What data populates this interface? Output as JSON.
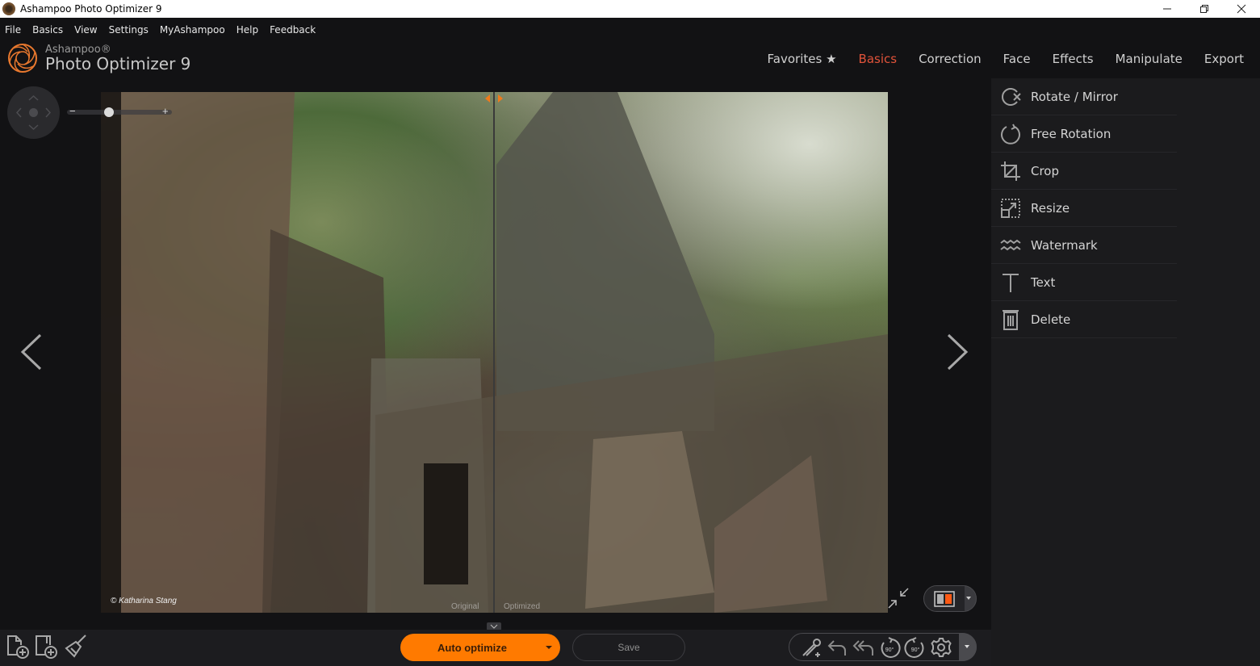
{
  "window": {
    "title": "Ashampoo Photo Optimizer 9",
    "controls": {
      "minimize": "minimize-icon",
      "restore": "restore-icon",
      "close": "close-icon"
    }
  },
  "menu": [
    "File",
    "Basics",
    "View",
    "Settings",
    "MyAshampoo",
    "Help",
    "Feedback"
  ],
  "brand": {
    "company": "Ashampoo®",
    "product": "Photo Optimizer 9",
    "logo_color": "#e8782e"
  },
  "tabs": [
    {
      "label": "Favorites ★",
      "active": false
    },
    {
      "label": "Basics",
      "active": true
    },
    {
      "label": "Correction",
      "active": false
    },
    {
      "label": "Face",
      "active": false
    },
    {
      "label": "Effects",
      "active": false
    },
    {
      "label": "Manipulate",
      "active": false
    },
    {
      "label": "Export",
      "active": false
    }
  ],
  "zoom": {
    "minus": "−",
    "plus": "+",
    "level_fraction": 0.35
  },
  "photo": {
    "credit": "© Katharina Stang",
    "left_label": "Original",
    "right_label": "Optimized"
  },
  "sidebar": {
    "items": [
      {
        "label": "Rotate / Mirror",
        "icon": "rotate-mirror-icon"
      },
      {
        "label": "Free Rotation",
        "icon": "free-rotation-icon"
      },
      {
        "label": "Crop",
        "icon": "crop-icon"
      },
      {
        "label": "Resize",
        "icon": "resize-icon"
      },
      {
        "label": "Watermark",
        "icon": "watermark-icon"
      },
      {
        "label": "Text",
        "icon": "text-icon"
      },
      {
        "label": "Delete",
        "icon": "delete-icon"
      }
    ]
  },
  "bottom": {
    "auto_optimize": "Auto optimize",
    "save": "Save",
    "left_tools": [
      "add-file-icon",
      "add-folder-icon",
      "clean-brush-icon"
    ],
    "right_tools": [
      "magic-wand-icon",
      "undo-icon",
      "undo-all-icon",
      "rotate-left-90-icon",
      "rotate-right-90-icon",
      "settings-gear-icon"
    ],
    "rotate_label": "90°"
  },
  "colors": {
    "accent": "#ff7a00",
    "active_tab": "#e0533a",
    "background": "#121214",
    "sidebar": "#1b1b1d"
  }
}
